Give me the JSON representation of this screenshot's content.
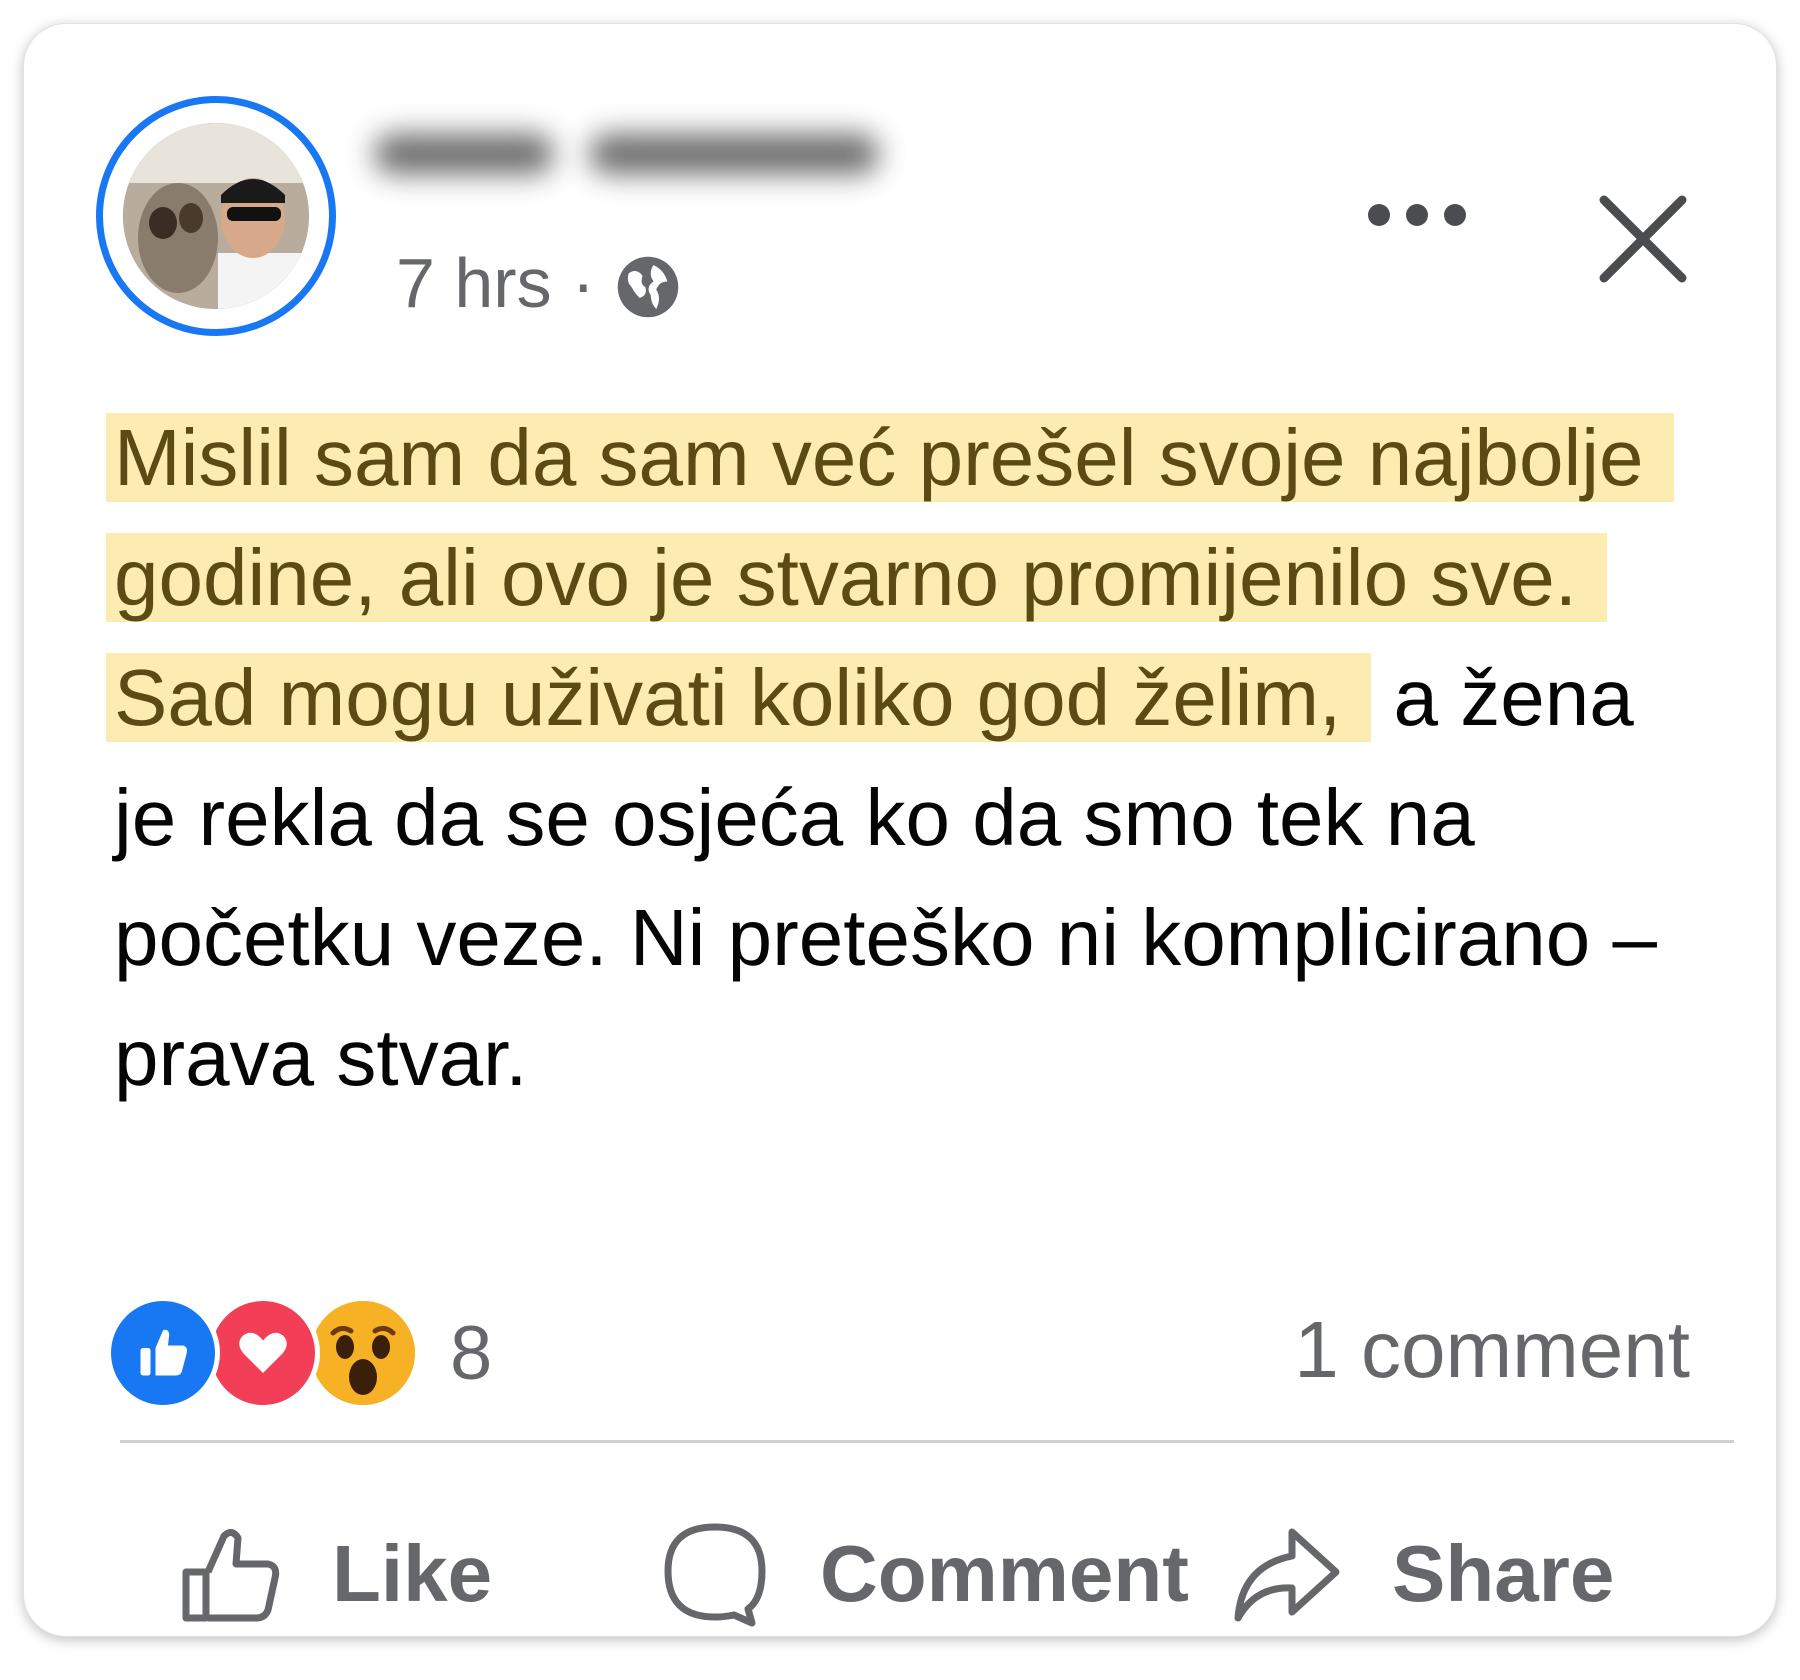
{
  "post": {
    "author_name": "",
    "timestamp": "7 hrs",
    "separator": "·",
    "privacy_icon": "globe-icon",
    "text_highlighted_1": "Mislil sam da sam već prešel svoje najbolje godine, ali ovo je stvarno promijenilo sve.",
    "text_highlighted_2": "Sad mogu uživati koliko god želim,",
    "text_rest": " a žena je rekla da se osjeća ko da smo tek na početku veze. Ni preteško ni komplicirano – prava stvar."
  },
  "header_actions": {
    "more_icon": "more-horizontal-icon",
    "close_icon": "close-icon"
  },
  "reactions": {
    "types": [
      "like-icon",
      "love-icon",
      "wow-icon"
    ],
    "count": "8"
  },
  "comments": {
    "count_label": "1 comment"
  },
  "actions": {
    "like_label": "Like",
    "comment_label": "Comment",
    "share_label": "Share"
  },
  "colors": {
    "accent": "#1877f2",
    "highlight": "#fcecb1",
    "love": "#f33e58",
    "wow": "#f7b125"
  }
}
